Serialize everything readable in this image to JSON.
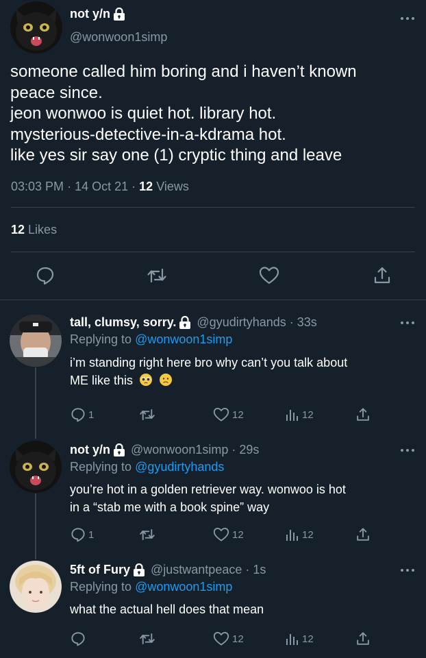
{
  "main_tweet": {
    "author_name": "not y/n",
    "handle": "@wonwoon1simp",
    "text_lines": [
      "someone called him boring and i haven’t known",
      "peace since.",
      "jeon wonwoo is quiet hot. library hot.",
      "mysterious-detective-in-a-kdrama hot.",
      "like yes sir say one (1) cryptic thing and leave"
    ],
    "time": "03:03 PM",
    "date": "14 Oct 21",
    "views_count": "12",
    "views_label": "Views",
    "likes_count": "12",
    "likes_label": "Likes",
    "separator": "·"
  },
  "replies": [
    {
      "author_name": "tall, clumsy, sorry.",
      "handle": "@gyudirtyhands · 33s",
      "replying_prefix": "Replying to",
      "replying_to": "@wonwoon1simp",
      "text_lines": [
        "i’m standing right here bro why can’t you talk about",
        "ME like this"
      ],
      "emojis": [
        "pleading-face",
        "worried-face"
      ],
      "reply_count": "1",
      "like_count": "12",
      "view_count": "12"
    },
    {
      "author_name": "not y/n",
      "handle": "@wonwoon1simp · 29s",
      "replying_prefix": "Replying to",
      "replying_to": "@gyudirtyhands",
      "text_lines": [
        "you’re hot in a golden retriever way. wonwoo is hot",
        "in a “stab me with a book spine” way"
      ],
      "reply_count": "1",
      "like_count": "12",
      "view_count": "12"
    },
    {
      "author_name": "5ft of Fury",
      "handle": "@justwantpeace · 1s",
      "replying_prefix": "Replying to",
      "replying_to": "@wonwoon1simp",
      "text_lines": [
        "what the actual hell does that mean"
      ],
      "reply_count": "",
      "like_count": "12",
      "view_count": "12"
    }
  ],
  "colors": {
    "background": "#15202b",
    "muted": "#8899a6",
    "link": "#1d9bf0",
    "divider": "#38444d"
  }
}
